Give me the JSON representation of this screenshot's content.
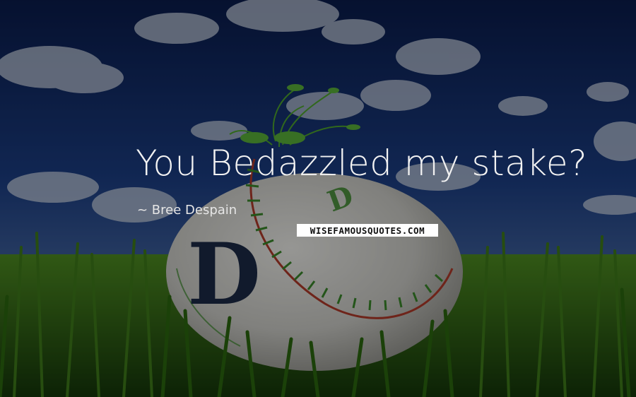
{
  "quote": {
    "text": "You Bedazzled my stake?"
  },
  "author": {
    "name": "~ Bree Despain"
  },
  "watermark": {
    "text": "WISEFAMOUSQUOTES.COM"
  },
  "colors": {
    "sky": "#0f2a66",
    "grass": "#2f6b12",
    "ball": "#d9d9d6",
    "stitch": "#3a8a2a",
    "text": "#f2f2f2"
  }
}
